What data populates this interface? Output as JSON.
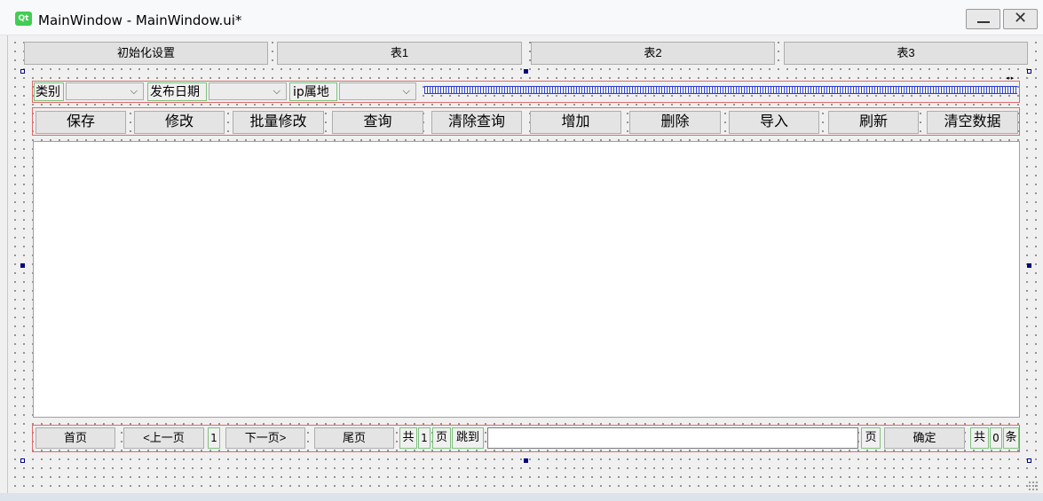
{
  "window": {
    "logo_text": "Qt",
    "title": "MainWindow - MainWindow.ui*",
    "close_glyph": "✕"
  },
  "top_buttons": [
    "初始化设置",
    "表1",
    "表2",
    "表3"
  ],
  "filters": {
    "category_label": "类别",
    "date_label": "发布日期",
    "ip_label": "ip属地",
    "chevron": "⌵"
  },
  "toolbar": [
    "保存",
    "修改",
    "批量修改",
    "查询",
    "清除查询",
    "增加",
    "删除",
    "导入",
    "刷新",
    "清空数据"
  ],
  "pager": {
    "first": "首页",
    "prev": "<上一页",
    "current_page": "1",
    "next": "下一页>",
    "last": "尾页",
    "total_prefix": "共",
    "total_pages": "1",
    "page_unit": "页",
    "jump_label": "跳到",
    "jump_value": "",
    "jump_unit": "页",
    "confirm": "确定",
    "count_prefix": "共",
    "total_records": "0",
    "record_unit": "条"
  },
  "colors": {
    "layout_border": "#e06a6a",
    "widget_border": "#80c080",
    "spacer": "#2a3cd0",
    "selection_handle": "#000080",
    "qt_green": "#41cd52"
  },
  "icons": [
    "qt-logo-icon",
    "minimize-icon",
    "close-icon",
    "chevron-down-icon",
    "resize-grip-icon"
  ]
}
